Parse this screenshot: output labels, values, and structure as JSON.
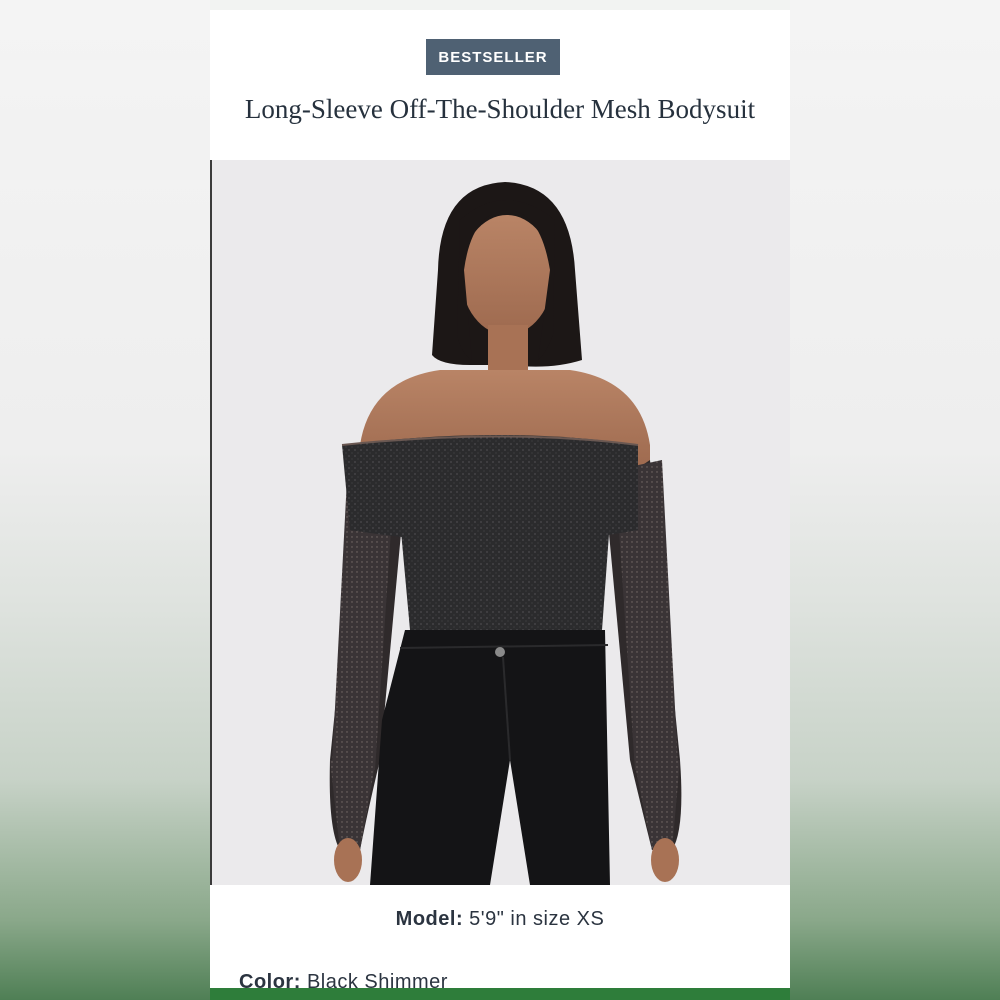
{
  "badge": "BESTSELLER",
  "product": {
    "title": "Long-Sleeve Off-The-Shoulder Mesh Bodysuit"
  },
  "model": {
    "label": "Model:",
    "value": "5'9\" in size XS"
  },
  "color": {
    "label": "Color:",
    "value": "Black Shimmer"
  },
  "colors": {
    "badge_bg": "#4f6173",
    "title_text": "#26313d",
    "accent_green": "#2e7d3a"
  }
}
